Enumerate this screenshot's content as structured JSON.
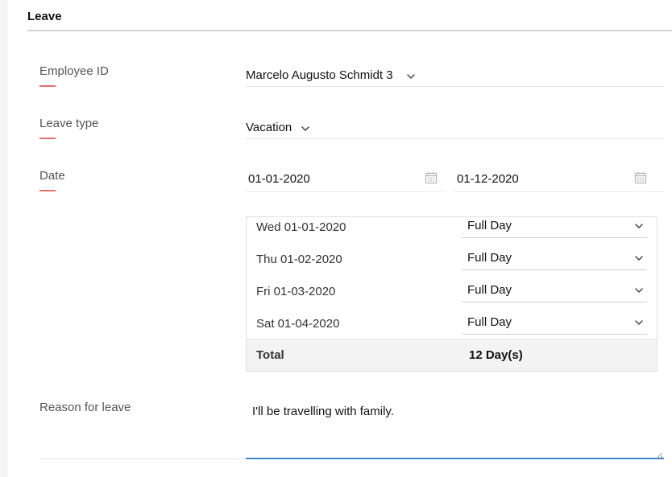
{
  "section": {
    "title": "Leave"
  },
  "employee": {
    "label": "Employee ID",
    "value": "Marcelo Augusto Schmidt 3",
    "icon": "chevron-down-icon"
  },
  "leave_type": {
    "label": "Leave type",
    "value": "Vacation",
    "icon": "chevron-down-icon"
  },
  "date": {
    "label": "Date",
    "from": "01-01-2020",
    "to": "01-12-2020",
    "icon": "calendar-icon"
  },
  "days": [
    {
      "day": "Wed 01-01-2020",
      "type": "Full Day"
    },
    {
      "day": "Thu 01-02-2020",
      "type": "Full Day"
    },
    {
      "day": "Fri 01-03-2020",
      "type": "Full Day"
    },
    {
      "day": "Sat 01-04-2020",
      "type": "Full Day"
    }
  ],
  "total": {
    "label": "Total",
    "value": "12 Day(s)"
  },
  "reason": {
    "label": "Reason for leave",
    "value": "I'll be travelling with family."
  },
  "colors": {
    "label_accent": "#e2716b",
    "focus_border": "#3b86d4",
    "total_row_bg": "#f3f3f4"
  }
}
